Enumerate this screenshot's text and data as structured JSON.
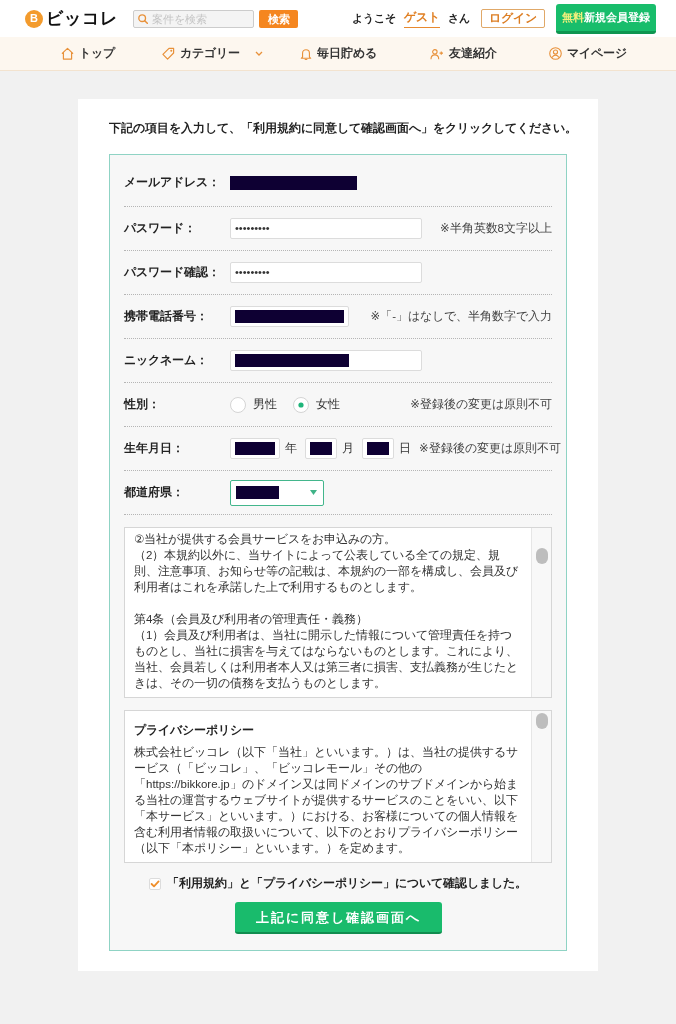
{
  "header": {
    "logo": {
      "mark": "B",
      "text": "ビッコレ"
    },
    "search": {
      "placeholder": "案件を検索",
      "button": "検索"
    },
    "greeting": {
      "prefix": "ようこそ",
      "name": "ゲスト",
      "suffix": "さん"
    },
    "login_button": "ログイン",
    "signup_button": {
      "highlight": "無料",
      "label": "新規会員登録"
    }
  },
  "nav": [
    {
      "label": "トップ",
      "dropdown": false
    },
    {
      "label": "カテゴリー",
      "dropdown": true
    },
    {
      "label": "毎日貯める",
      "dropdown": false
    },
    {
      "label": "友達紹介",
      "dropdown": false
    },
    {
      "label": "マイページ",
      "dropdown": false
    }
  ],
  "instruction": "下記の項目を入力して、「利用規約に同意して確認画面へ」をクリックしてください。",
  "form": {
    "fields": [
      {
        "kind": "static",
        "label": "メールアドレス：",
        "redacted": true
      },
      {
        "kind": "text",
        "label": "パスワード：",
        "value": "•••••••••",
        "redacted": false,
        "note": "※半角英数8文字以上"
      },
      {
        "kind": "text",
        "label": "パスワード確認：",
        "value": "•••••••••",
        "redacted": false
      },
      {
        "kind": "tel",
        "label": "携帯電話番号：",
        "redacted": true,
        "note": "※「-」はなしで、半角数字で入力"
      },
      {
        "kind": "text",
        "label": "ニックネーム：",
        "redacted": true
      },
      {
        "kind": "radio",
        "label": "性別：",
        "options": [
          {
            "label": "男性",
            "selected": false
          },
          {
            "label": "女性",
            "selected": true
          }
        ],
        "note": "※登録後の変更は原則不可"
      },
      {
        "kind": "date",
        "label": "生年月日：",
        "parts": [
          {
            "unit": "年",
            "redacted": true
          },
          {
            "unit": "月",
            "redacted": true
          },
          {
            "unit": "日",
            "redacted": true
          }
        ],
        "note": "※登録後の変更は原則不可"
      },
      {
        "kind": "select",
        "label": "都道府県：",
        "redacted": true
      }
    ]
  },
  "terms": {
    "sections": [
      {
        "lines": [
          "②当社が提供する会員サービスをお申込みの方。",
          "（2）本規約以外に、当サイトによって公表している全ての規定、規則、注意事項、お知らせ等の記載は、本規約の一部を構成し、会員及び利用者はこれを承諾した上で利用するものとします。"
        ]
      },
      {
        "lines": [
          "第4条（会員及び利用者の管理責任・義務）",
          "（1）会員及び利用者は、当社に開示した情報について管理責任を持つものとし、当社に損害を与えてはならないものとします。これにより、当社、会員若しくは利用者本人又は第三者に損害、支払義務が生じたときは、その一切の債務を支払うものとします。"
        ]
      }
    ]
  },
  "privacy": {
    "title": "プライバシーポリシー",
    "text": "株式会社ビッコレ（以下「当社」といいます。）は、当社の提供するサービス（「ビッコレ」、「ビッコレモール」その他の「https://bikkore.jp」のドメイン又は同ドメインのサブドメインから始まる当社の運営するウェブサイトが提供するサービスのことをいい、以下「本サービス」といいます。）における、お客様についての個人情報を含む利用者情報の取扱いについて、以下のとおりプライバシーポリシー（以下「本ポリシー」といいます。）を定めます。"
  },
  "agreement": {
    "label": "「利用規約」と「プライバシーポリシー」について確認しました。",
    "checked": true
  },
  "submit_button": "上記に同意し確認画面へ"
}
